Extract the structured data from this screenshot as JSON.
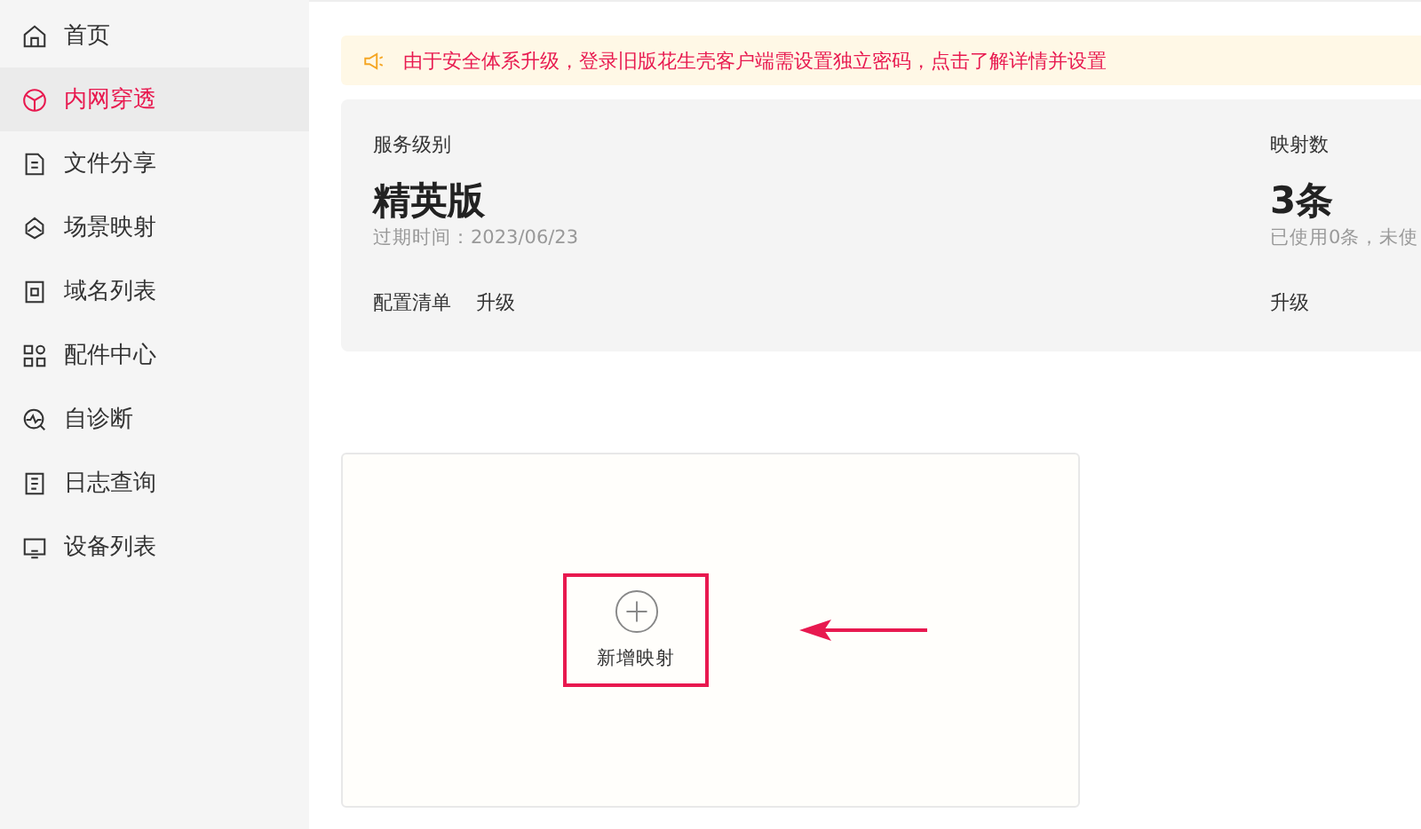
{
  "sidebar": {
    "items": [
      {
        "label": "首页",
        "selected": false
      },
      {
        "label": "内网穿透",
        "selected": true
      },
      {
        "label": "文件分享",
        "selected": false
      },
      {
        "label": "场景映射",
        "selected": false
      },
      {
        "label": "域名列表",
        "selected": false
      },
      {
        "label": "配件中心",
        "selected": false
      },
      {
        "label": "自诊断",
        "selected": false
      },
      {
        "label": "日志查询",
        "selected": false
      },
      {
        "label": "设备列表",
        "selected": false
      }
    ]
  },
  "notice": {
    "text": "由于安全体系升级，登录旧版花生壳客户端需设置独立密码，点击了解详情并设置"
  },
  "service": {
    "label": "服务级别",
    "value": "精英版",
    "detail": "过期时间：2023/06/23",
    "links": [
      "配置清单",
      "升级"
    ]
  },
  "mapping": {
    "label": "映射数",
    "value": "3条",
    "detail": "已使用0条，未使",
    "links": [
      "升级"
    ]
  },
  "add_button": {
    "label": "新增映射"
  }
}
